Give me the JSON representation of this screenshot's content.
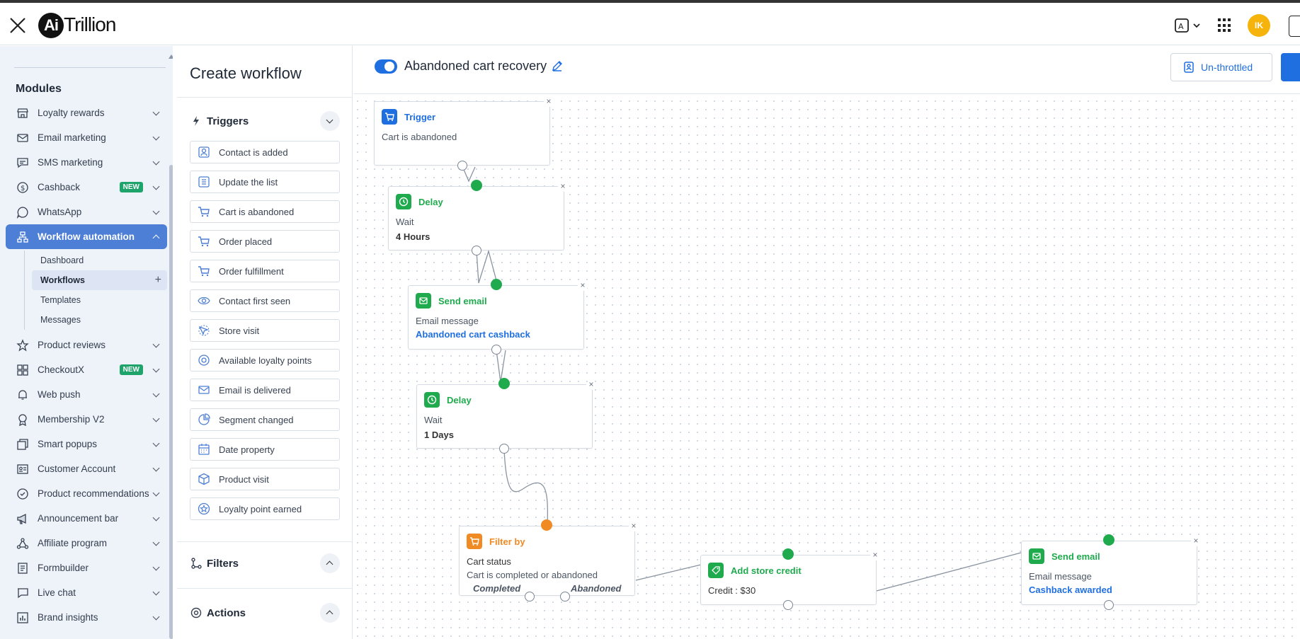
{
  "app": {
    "logo_mark": "Ai",
    "logo_text": "Trillion",
    "avatar_initials": "IK"
  },
  "topbar": {
    "close_icon": "close-icon",
    "translate_icon": "translate-icon",
    "apps_icon": "apps-grid-icon"
  },
  "sidebar": {
    "section_title": "Modules",
    "items": [
      {
        "label": "Loyalty rewards",
        "icon": "store-icon"
      },
      {
        "label": "Email marketing",
        "icon": "mail-icon"
      },
      {
        "label": "SMS marketing",
        "icon": "chat-icon"
      },
      {
        "label": "Cashback",
        "icon": "dollar-icon",
        "badge": "NEW"
      },
      {
        "label": "WhatsApp",
        "icon": "whatsapp-icon"
      },
      {
        "label": "Workflow automation",
        "icon": "workflow-icon",
        "active": true
      },
      {
        "label": "Product reviews",
        "icon": "star-icon"
      },
      {
        "label": "CheckoutX",
        "icon": "grid-icon",
        "badge": "NEW"
      },
      {
        "label": "Web push",
        "icon": "bell-icon"
      },
      {
        "label": "Membership V2",
        "icon": "award-icon"
      },
      {
        "label": "Smart popups",
        "icon": "popup-icon"
      },
      {
        "label": "Customer Account",
        "icon": "id-card-icon"
      },
      {
        "label": "Product recommendations",
        "icon": "recommend-icon"
      },
      {
        "label": "Announcement bar",
        "icon": "megaphone-icon"
      },
      {
        "label": "Affiliate program",
        "icon": "network-icon"
      },
      {
        "label": "Formbuilder",
        "icon": "form-icon"
      },
      {
        "label": "Live chat",
        "icon": "chat-bubble-icon"
      },
      {
        "label": "Brand insights",
        "icon": "chart-icon"
      }
    ],
    "submenu": [
      {
        "label": "Dashboard"
      },
      {
        "label": "Workflows",
        "active": true
      },
      {
        "label": "Templates"
      },
      {
        "label": "Messages"
      }
    ]
  },
  "panel": {
    "title": "Create workflow",
    "triggers_title": "Triggers",
    "filters_title": "Filters",
    "actions_title": "Actions",
    "triggers": [
      {
        "label": "Contact is added",
        "icon": "contact-icon"
      },
      {
        "label": "Update the list",
        "icon": "list-icon"
      },
      {
        "label": "Cart is abandoned",
        "icon": "cart-icon"
      },
      {
        "label": "Order placed",
        "icon": "cart-icon"
      },
      {
        "label": "Order fulfillment",
        "icon": "cart-icon"
      },
      {
        "label": "Contact first seen",
        "icon": "eye-icon"
      },
      {
        "label": "Store visit",
        "icon": "visit-icon"
      },
      {
        "label": "Available loyalty points",
        "icon": "loyalty-icon"
      },
      {
        "label": "Email is delivered",
        "icon": "email-delivered-icon"
      },
      {
        "label": "Segment changed",
        "icon": "pie-icon"
      },
      {
        "label": "Date property",
        "icon": "calendar-icon"
      },
      {
        "label": "Product visit",
        "icon": "box-icon"
      },
      {
        "label": "Loyalty point earned",
        "icon": "star-badge-icon"
      }
    ]
  },
  "canvas": {
    "workflow_name": "Abandoned cart recovery",
    "workflow_enabled": true,
    "throttle_label": "Un-throttled",
    "nodes": {
      "trigger": {
        "title": "Trigger",
        "line1": "Cart is abandoned",
        "color": "#1f6fe0"
      },
      "delay1": {
        "title": "Delay",
        "line1": "Wait",
        "line2": "4 Hours",
        "color": "#1faa4d"
      },
      "email1": {
        "title": "Send email",
        "line1": "Email message",
        "line2": "Abandoned cart cashback",
        "color": "#1faa4d"
      },
      "delay2": {
        "title": "Delay",
        "line1": "Wait",
        "line2": "1 Days",
        "color": "#1faa4d"
      },
      "filter": {
        "title": "Filter by",
        "line1": "Cart status",
        "line2": "Cart is completed or abandoned",
        "branch_yes": "Completed",
        "branch_no": "Abandoned",
        "color": "#f08a24"
      },
      "credit": {
        "title": "Add store credit",
        "line1": "Credit : $30",
        "color": "#1faa4d"
      },
      "email2": {
        "title": "Send email",
        "line1": "Email message",
        "line2": "Cashback awarded",
        "color": "#1faa4d"
      }
    },
    "remove_symbol": "×"
  }
}
